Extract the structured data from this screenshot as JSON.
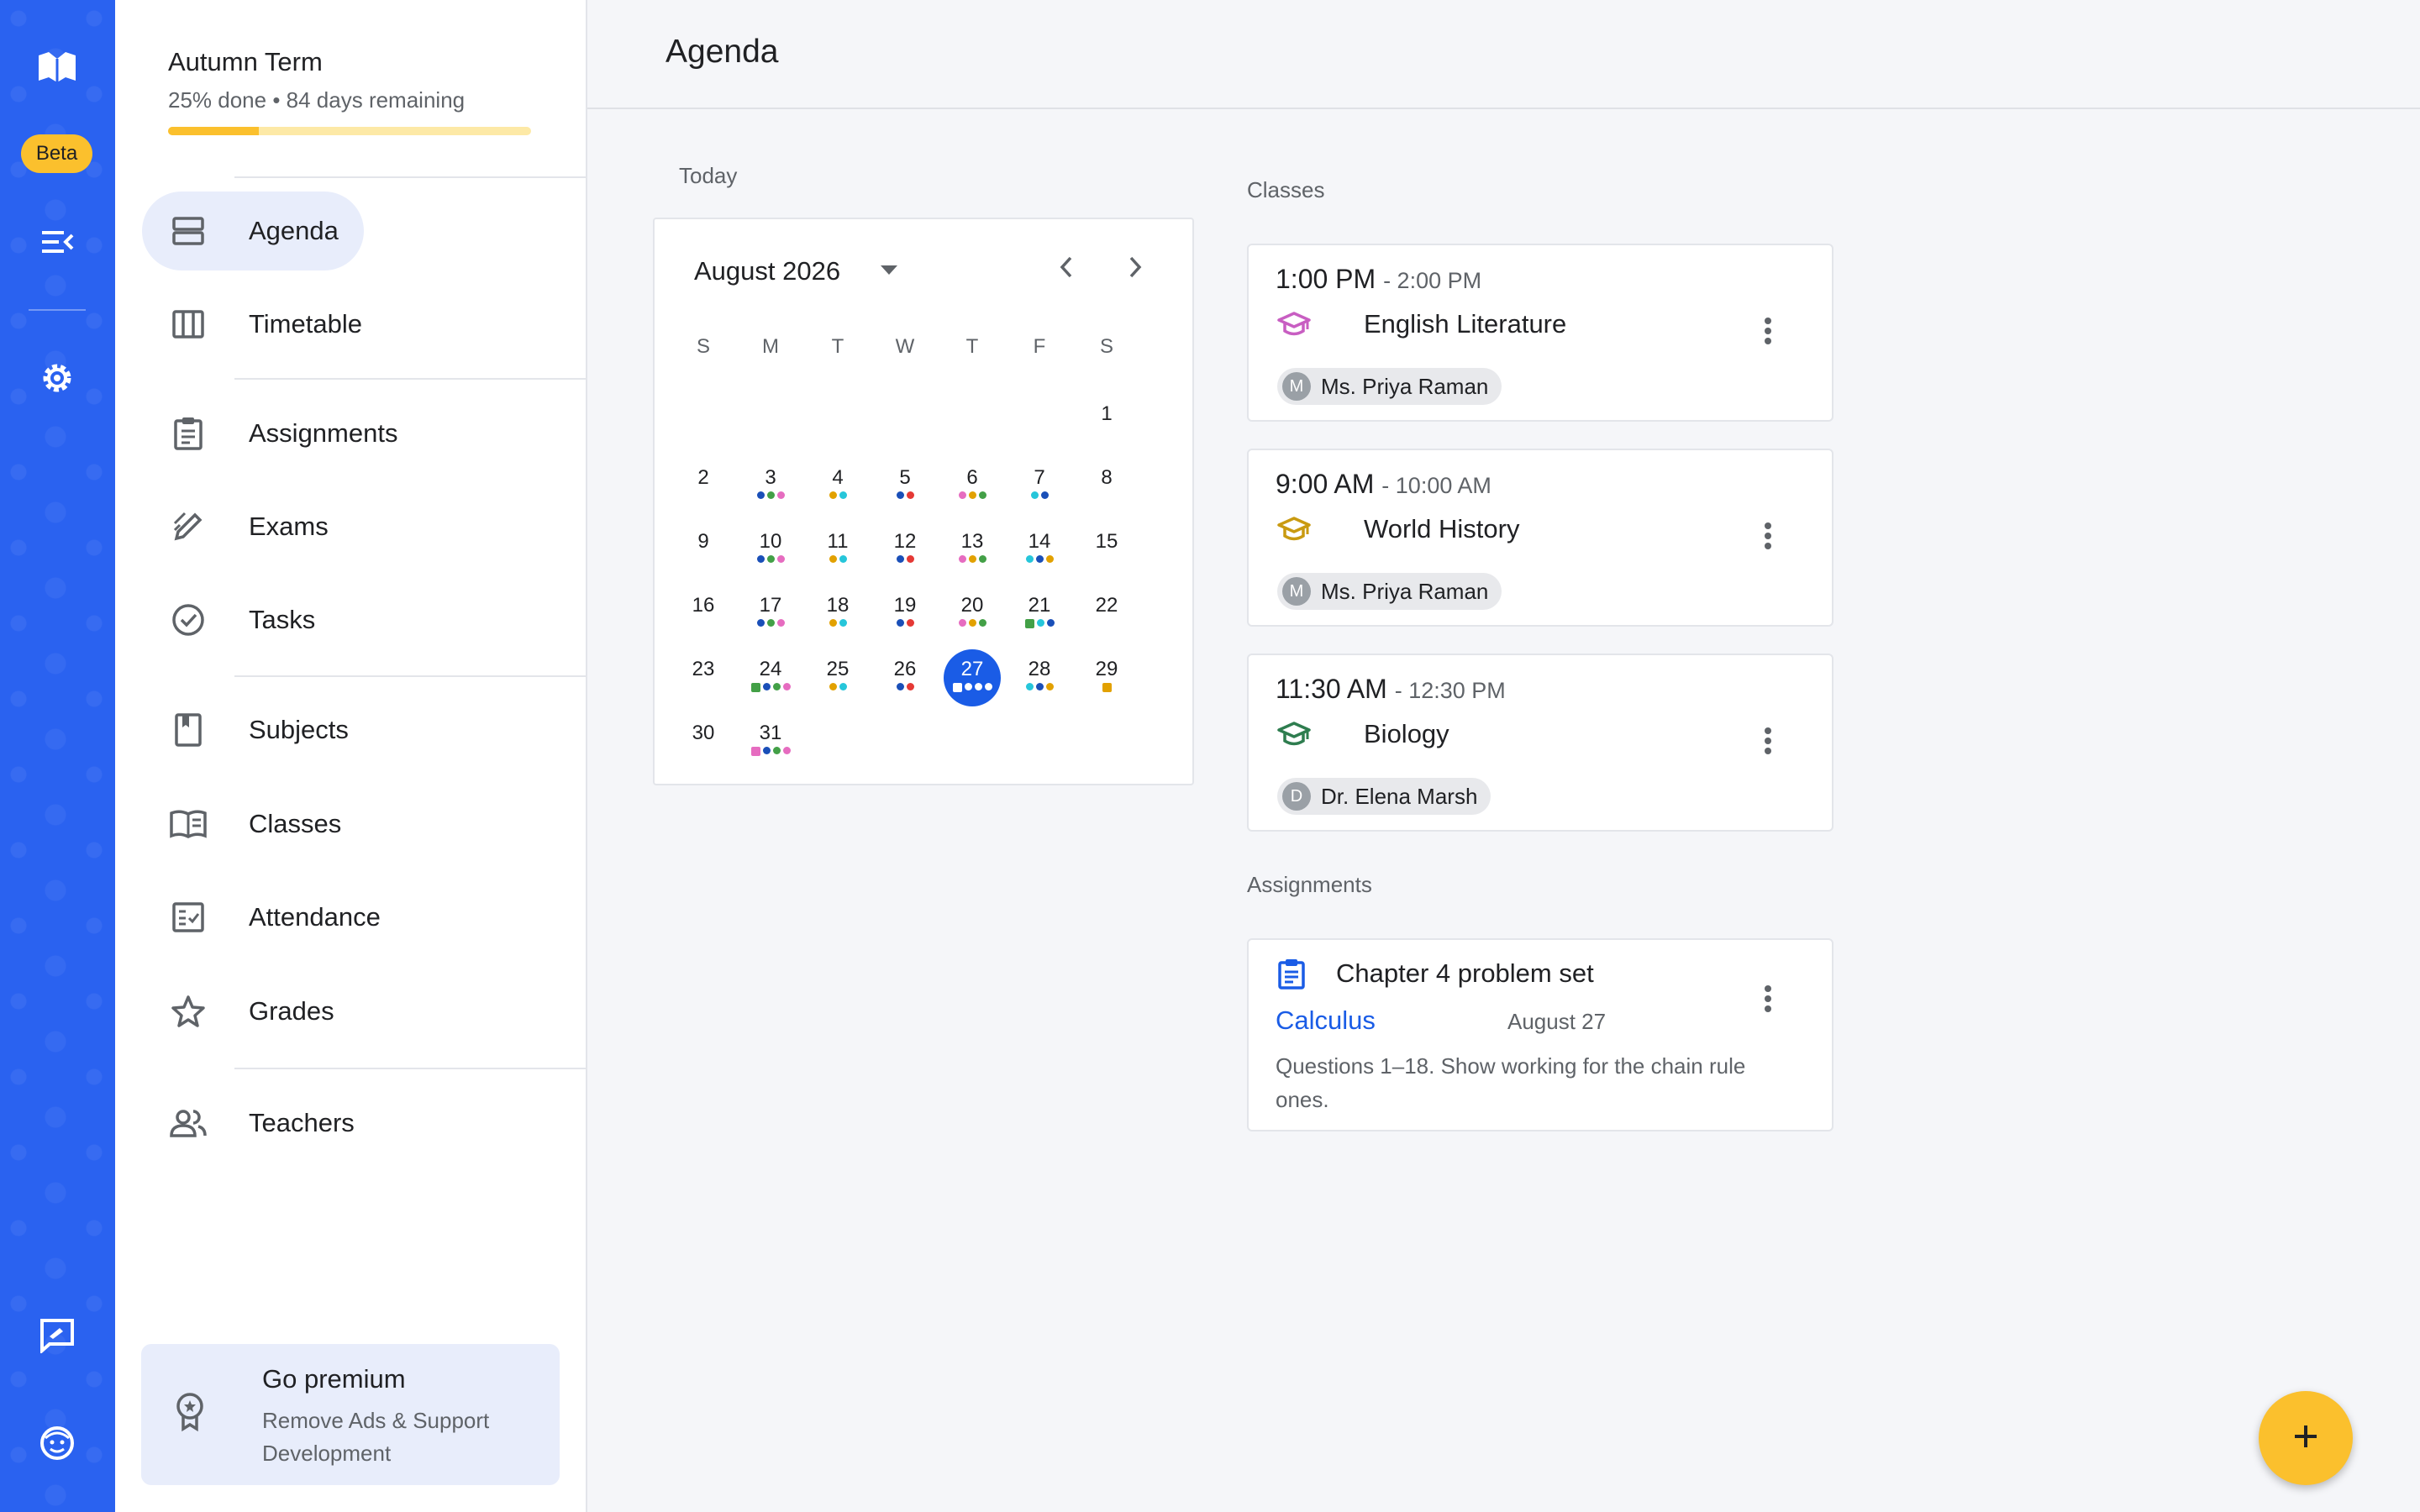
{
  "rail": {
    "badge": "Beta",
    "icons": [
      "logo-icon",
      "collapse-menu-icon",
      "settings-icon",
      "feedback-icon",
      "account-icon"
    ],
    "accent": "#2a62f0"
  },
  "term": {
    "title": "Autumn Term",
    "subtitle": "25% done • 84 days remaining",
    "progress": 0.25
  },
  "nav": [
    {
      "label": "Agenda",
      "icon": "agenda-icon",
      "active": true
    },
    {
      "label": "Timetable",
      "icon": "timetable-icon"
    },
    {
      "label": "Assignments",
      "icon": "assignments-icon"
    },
    {
      "label": "Exams",
      "icon": "exams-icon"
    },
    {
      "label": "Tasks",
      "icon": "tasks-icon"
    },
    {
      "label": "Subjects",
      "icon": "subjects-icon"
    },
    {
      "label": "Classes",
      "icon": "classes-icon"
    },
    {
      "label": "Attendance",
      "icon": "attendance-icon"
    },
    {
      "label": "Grades",
      "icon": "grades-icon"
    },
    {
      "label": "Teachers",
      "icon": "teachers-icon"
    }
  ],
  "premium": {
    "title": "Go premium",
    "subtitle": "Remove Ads & Support Development"
  },
  "header": {
    "title": "Agenda"
  },
  "calendar": {
    "section_label": "Today",
    "month": "August 2026",
    "weekdays": [
      "S",
      "M",
      "T",
      "W",
      "T",
      "F",
      "S"
    ],
    "first_weekday": 6,
    "days": 31,
    "today": 27,
    "colors": {
      "b": "#1a4fb8",
      "g": "#43a047",
      "p": "#e66cc0",
      "o": "#e2a100",
      "c": "#26c6da",
      "r": "#e53935"
    },
    "markers": {
      "3": [
        "b",
        "g",
        "p"
      ],
      "4": [
        "o",
        "c"
      ],
      "5": [
        "b",
        "r"
      ],
      "6": [
        "p",
        "o",
        "g"
      ],
      "7": [
        "c",
        "b"
      ],
      "10": [
        "b",
        "g",
        "p"
      ],
      "11": [
        "o",
        "c"
      ],
      "12": [
        "b",
        "r"
      ],
      "13": [
        "p",
        "o",
        "g"
      ],
      "14": [
        "c",
        "b",
        "o"
      ],
      "17": [
        "b",
        "g",
        "p"
      ],
      "18": [
        "o",
        "c"
      ],
      "19": [
        "b",
        "r"
      ],
      "20": [
        "p",
        "o",
        "g"
      ],
      "21": [
        "sq-g",
        "c",
        "b"
      ],
      "24": [
        "sq-g",
        "b",
        "g",
        "p"
      ],
      "25": [
        "o",
        "c"
      ],
      "26": [
        "b",
        "r"
      ],
      "27": [
        "sq-w",
        "w",
        "w",
        "w"
      ],
      "28": [
        "c",
        "b",
        "o"
      ],
      "29": [
        "sq-o"
      ],
      "31": [
        "sq-p",
        "b",
        "g",
        "p"
      ]
    }
  },
  "classes": {
    "section_label": "Classes",
    "items": [
      {
        "start": "1:00 PM",
        "end": "- 2:00 PM",
        "name": "English Literature",
        "icon_color": "#c85ec2",
        "teacher_initial": "M",
        "teacher": "Ms. Priya Raman"
      },
      {
        "start": "9:00 AM",
        "end": "- 10:00 AM",
        "name": "World History",
        "icon_color": "#c99a10",
        "teacher_initial": "M",
        "teacher": "Ms. Priya Raman"
      },
      {
        "start": "11:30 AM",
        "end": "- 12:30 PM",
        "name": "Biology",
        "icon_color": "#2e7d4f",
        "teacher_initial": "D",
        "teacher": "Dr. Elena Marsh"
      }
    ]
  },
  "assignments": {
    "section_label": "Assignments",
    "items": [
      {
        "title": "Chapter 4 problem set",
        "subject": "Calculus",
        "due": "August 27",
        "description": "Questions 1–18. Show working for the chain rule ones."
      }
    ]
  },
  "fab": {
    "icon": "plus-icon"
  }
}
